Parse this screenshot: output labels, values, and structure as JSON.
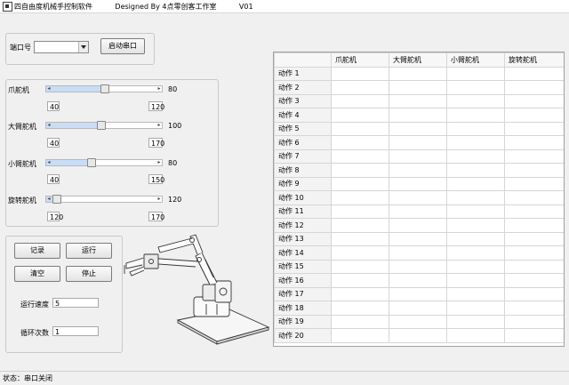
{
  "window": {
    "title": "四自由度机械手控制软件          Designed By 4点零创客工作室          V01"
  },
  "port": {
    "label": "端口号",
    "selected": "",
    "connect_button": "启动串口"
  },
  "servos": [
    {
      "name": "爪舵机",
      "value": "80",
      "min": "40",
      "max": "120",
      "level": 0.5
    },
    {
      "name": "大臂舵机",
      "value": "100",
      "min": "40",
      "max": "170",
      "level": 0.46
    },
    {
      "name": "小臂舵机",
      "value": "80",
      "min": "40",
      "max": "150",
      "level": 0.36
    },
    {
      "name": "旋转舵机",
      "value": "120",
      "min": "120",
      "max": "170",
      "level": 0.0
    }
  ],
  "controls": {
    "record": "记录",
    "run": "运行",
    "clear": "清空",
    "stop": "停止",
    "speed_label": "运行速度",
    "speed_value": "5",
    "loop_label": "循环次数",
    "loop_value": "1"
  },
  "table": {
    "columns": [
      "",
      "爪舵机",
      "大臂舵机",
      "小臂舵机",
      "旋转舵机"
    ],
    "rows": [
      "动作 1",
      "动作 2",
      "动作 3",
      "动作 4",
      "动作 5",
      "动作 6",
      "动作 7",
      "动作 8",
      "动作 9",
      "动作 10",
      "动作 11",
      "动作 12",
      "动作 13",
      "动作 14",
      "动作 15",
      "动作 16",
      "动作 17",
      "动作 18",
      "动作 19",
      "动作 20"
    ]
  },
  "status": {
    "text": "状态：串口关闭"
  },
  "icons": {
    "app": "robot-arm-app-icon",
    "illustration": "robot-arm-illustration"
  }
}
